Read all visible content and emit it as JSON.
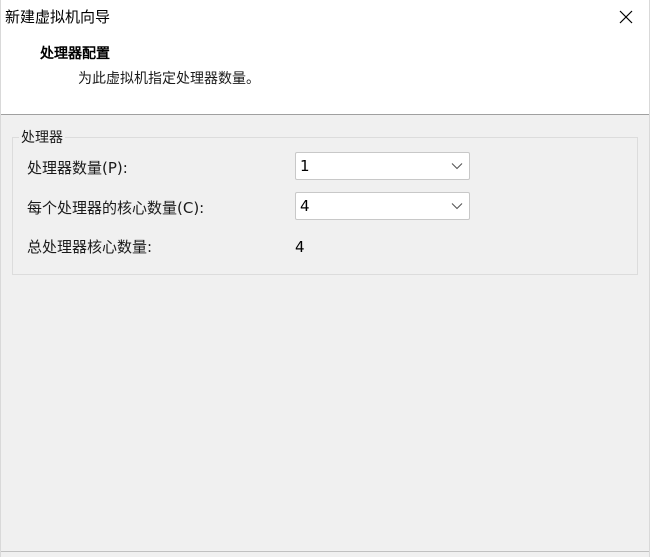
{
  "window": {
    "title": "新建虚拟机向导"
  },
  "header": {
    "title": "处理器配置",
    "subtitle": "为此虚拟机指定处理器数量。"
  },
  "processor_group": {
    "legend": "处理器",
    "processor_count": {
      "label": "处理器数量(P):",
      "value": "1"
    },
    "cores_per_processor": {
      "label": "每个处理器的核心数量(C):",
      "value": "4"
    },
    "total_cores": {
      "label": "总处理器核心数量:",
      "value": "4"
    }
  },
  "icons": {
    "close": "close-icon",
    "dropdown": "chevron-down-icon"
  },
  "colors": {
    "window_bg": "#f0f0f0",
    "header_bg": "#ffffff",
    "group_border": "#dcdcdc"
  }
}
